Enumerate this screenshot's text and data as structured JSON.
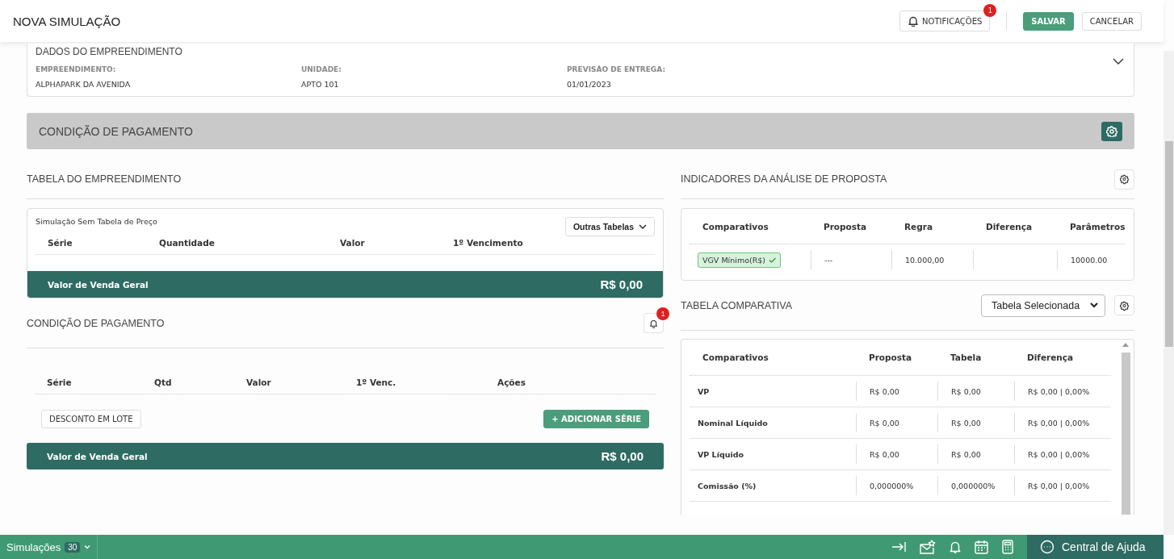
{
  "header": {
    "title": "NOVA SIMULAÇÃO",
    "notifications": {
      "label": "NOTIFICAÇÕES",
      "badge": "1"
    },
    "buttons": [
      {
        "label": "SALVAR",
        "kind": "primary"
      },
      {
        "label": "CANCELAR",
        "kind": "secondary"
      }
    ]
  },
  "dados": {
    "title": "DADOS DO EMPREENDIMENTO",
    "fields": [
      {
        "label": "EMPREENDIMENTO:",
        "value": "ALPHAPARK DA AVENIDA"
      },
      {
        "label": "UNIDADE:",
        "value": "APTO 101"
      },
      {
        "label": "PREVISÃO DE ENTREGA:",
        "value": "01/01/2023"
      }
    ]
  },
  "condicao_bar": {
    "title": "CONDIÇÃO DE PAGAMENTO"
  },
  "tabela_empreendimento": {
    "title": "TABELA DO EMPREENDIMENTO",
    "subtitle": "Simulação Sem Tabela de Preço",
    "dropdown": "Outras Tabelas",
    "columns": [
      "Série",
      "Quantidade",
      "Valor",
      "1º Vencimento"
    ],
    "total_label": "Valor de Venda Geral",
    "total": "R$ 0,00"
  },
  "condicao_pagamento": {
    "title": "CONDIÇÃO DE PAGAMENTO",
    "badge": "1",
    "columns": [
      "Série",
      "Qtd",
      "Valor",
      "1º Venc.",
      "Ações"
    ],
    "buttons": [
      {
        "label": "DESCONTO EM LOTE",
        "kind": "secondary"
      },
      {
        "label": "+ ADICIONAR SÉRIE",
        "kind": "primary"
      }
    ],
    "total_label": "Valor de Venda Geral",
    "total": "R$ 0,00"
  },
  "indicadores": {
    "title": "INDICADORES DA ANÁLISE DE PROPOSTA",
    "columns": [
      "Comparativos",
      "Proposta",
      "Regra",
      "Diferença",
      "Parâmetros"
    ],
    "rows": [
      {
        "comparativo": "VGV Mínimo(R$)",
        "ok": true,
        "proposta": "---",
        "regra": "10.000,00",
        "parametros": "10000.00"
      }
    ]
  },
  "tabela_comparativa": {
    "title": "TABELA COMPARATIVA",
    "select": "Tabela Selecionada",
    "columns": [
      "Comparativos",
      "Proposta",
      "Tabela",
      "Diferença"
    ],
    "rows": [
      [
        "VP",
        "R$ 0,00",
        "R$ 0,00",
        "R$ 0,00 | 0,00%"
      ],
      [
        "Nominal Líquido",
        "R$ 0,00",
        "R$ 0,00",
        "R$ 0,00 | 0,00%"
      ],
      [
        "VP Líquido",
        "R$ 0,00",
        "R$ 0,00",
        "R$ 0,00 | 0,00%"
      ],
      [
        "Comissão (%)",
        "0,000000%",
        "0,000000%",
        "R$ 0,00 | 0,00%"
      ]
    ]
  },
  "footer": {
    "label": "Simulações",
    "count": "30",
    "help": "Central de Ajuda"
  }
}
